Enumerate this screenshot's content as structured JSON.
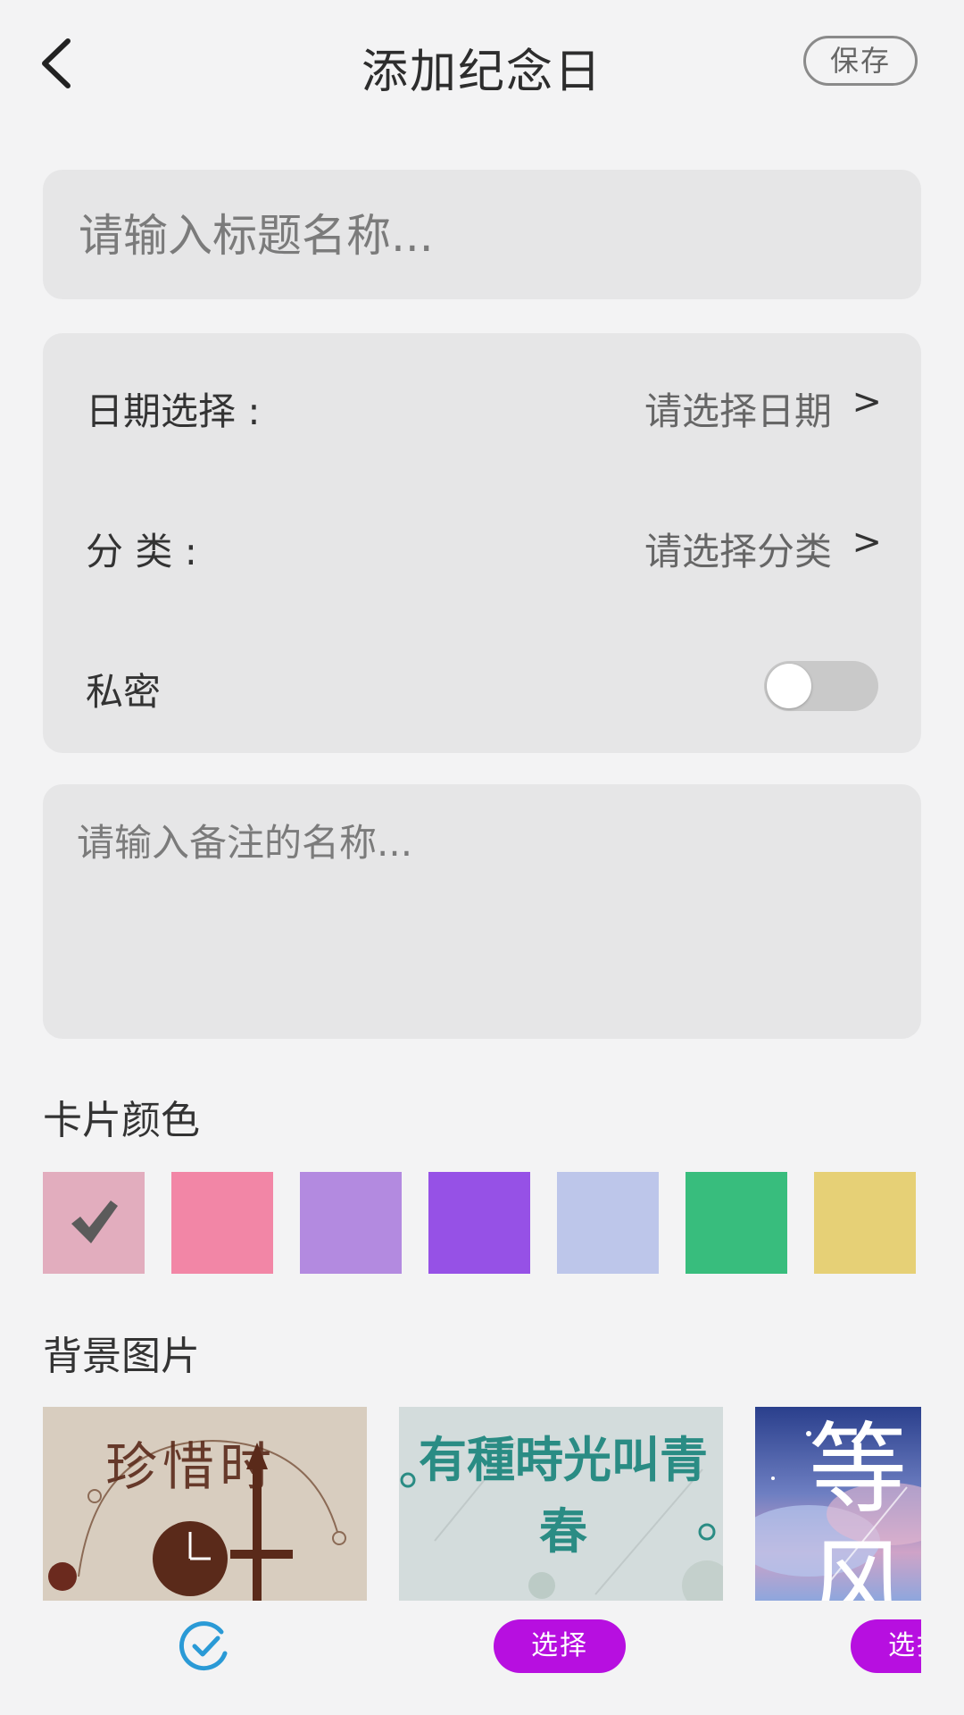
{
  "header": {
    "title": "添加纪念日",
    "save_label": "保存"
  },
  "title_input": {
    "placeholder": "请输入标题名称..."
  },
  "settings": {
    "date_label": "日期选择 :",
    "date_value": "请选择日期",
    "category_label": "分 类 :",
    "category_value": "请选择分类",
    "arrow": ">",
    "private_label": "私密",
    "private_on": false
  },
  "note_input": {
    "placeholder": "请输入备注的名称..."
  },
  "card_color": {
    "title": "卡片颜色",
    "swatches": [
      "#e2adbe",
      "#f286a6",
      "#b38ae0",
      "#9651e6",
      "#bdc6ea",
      "#38bd7d",
      "#e6d076"
    ],
    "selected_index": 0
  },
  "background": {
    "title": "背景图片",
    "select_label": "选择",
    "selected_index": 0,
    "images": [
      {
        "theme": "beige",
        "text": "珍惜时"
      },
      {
        "theme": "mint",
        "text": "有種時光叫青春"
      },
      {
        "theme": "night-sky",
        "text": "等风"
      }
    ]
  }
}
